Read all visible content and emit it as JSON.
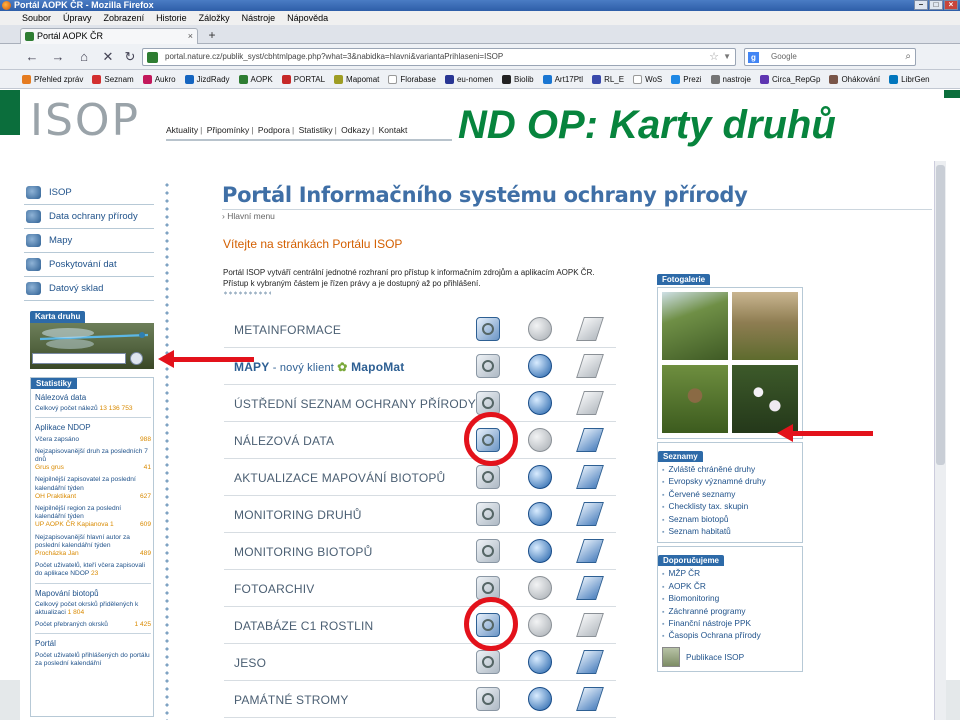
{
  "browser": {
    "window_title": "Portál AOPK ČR - Mozilla Firefox",
    "menu": [
      "Soubor",
      "Úpravy",
      "Zobrazení",
      "Historie",
      "Záložky",
      "Nástroje",
      "Nápověda"
    ],
    "tab_title": "Portál AOPK ČR",
    "url": "portal.nature.cz/publik_syst/cbhtmlpage.php?what=3&nabidka=hlavni&variantaPrihlaseni=ISOP",
    "search_placeholder": "Google",
    "bookmarks": [
      "Přehled zpráv",
      "Seznam",
      "Aukro",
      "JizdRady",
      "AOPK",
      "PORTAL",
      "Mapomat",
      "Florabase",
      "eu-nomen",
      "Biolib",
      "Art17Ptl",
      "RL_E",
      "WoS",
      "Prezi",
      "nastroje",
      "Circa_RepGp",
      "Ohákování",
      "LibrGen"
    ]
  },
  "header": {
    "logo_text": "ISOP",
    "nav": [
      "Aktuality",
      "Připomínky",
      "Podpora",
      "Statistiky",
      "Odkazy",
      "Kontakt"
    ],
    "slide_title": "ND OP: Karty druhů"
  },
  "left_menu": [
    "ISOP",
    "Data ochrany přírody",
    "Mapy",
    "Poskytování dat",
    "Datový sklad"
  ],
  "karta_druhu": {
    "label": "Karta druhu",
    "input_value": ""
  },
  "statistiky": {
    "label": "Statistiky",
    "nalezova_data": {
      "heading": "Nálezová data",
      "celkovy_label": "Celkový počet nálezů",
      "celkovy_value": "13 136 753"
    },
    "aplikace_ndop": {
      "heading": "Aplikace NDOP",
      "vcera_label": "Včera zapsáno",
      "vcera_value": "988",
      "druh_label": "Nejzapisovanější druh za posledních 7 dnů",
      "druh_name": "Grus grus",
      "druh_value": "41",
      "zapisovatel_label": "Nejpilnější zapisovatel za poslední kalendářní týden",
      "zapisovatel_name": "OH Praktikant",
      "zapisovatel_value": "627",
      "region_label": "Nejpilnější region za poslední kalendářní týden",
      "region_name": "UP AOPK ČR Kapianova 1",
      "region_value": "609",
      "autor_label": "Nejzapisovanější hlavní autor za poslední kalendářní týden",
      "autor_name": "Procházka Jan",
      "autor_value": "489",
      "uzivatele_label": "Počet uživatelů, kteří včera zapisovali do aplikace NDOP",
      "uzivatele_value": "23"
    },
    "mapovani": {
      "heading": "Mapování biotopů",
      "okrsky_label": "Celkový počet okrsků přidělených k aktualizaci",
      "okrsky_value": "1 804",
      "prebrane_label": "Počet přebraných okrsků",
      "prebrane_value": "1 425"
    },
    "portal": {
      "heading": "Portál",
      "label": "Počet uživatelů přihlášených do portálu za poslední kalendářní"
    }
  },
  "main": {
    "portal_title": "Portál Informačního systému ochrany přírody",
    "breadcrumb": "› Hlavní menu",
    "welcome": "Vítejte na stránkách Portálu ISOP",
    "intro_line1": "Portál ISOP vytváří centrální jednotné rozhraní pro přístup k informačním zdrojům a aplikacím AOPK ČR.",
    "intro_line2": "Přístup k vybraným částem je řízen právy a je dostupný až po přihlášení.",
    "apps": [
      {
        "name": "METAINFORMACE",
        "search": true,
        "globe": false,
        "doc": false
      },
      {
        "name": "MAPY",
        "extra": " - nový klient ",
        "extra2": "MapoMat",
        "search": false,
        "globe": true,
        "doc": false
      },
      {
        "name": "ÚSTŘEDNÍ SEZNAM OCHRANY PŘÍRODY",
        "search": false,
        "globe": true,
        "doc": false
      },
      {
        "name": "NÁLEZOVÁ DATA",
        "search": true,
        "globe": false,
        "doc": true
      },
      {
        "name": "AKTUALIZACE MAPOVÁNÍ BIOTOPŮ",
        "search": false,
        "globe": true,
        "doc": true
      },
      {
        "name": "MONITORING DRUHŮ",
        "search": false,
        "globe": true,
        "doc": true
      },
      {
        "name": "MONITORING BIOTOPŮ",
        "search": false,
        "globe": true,
        "doc": true
      },
      {
        "name": "FOTOARCHIV",
        "search": false,
        "globe": false,
        "doc": true
      },
      {
        "name": "DATABÁZE C1 ROSTLIN",
        "search": true,
        "globe": false,
        "doc": false
      },
      {
        "name": "JESO",
        "search": false,
        "globe": true,
        "doc": true
      },
      {
        "name": "PAMÁTNÉ STROMY",
        "search": false,
        "globe": true,
        "doc": true
      }
    ]
  },
  "right": {
    "fotogalerie_label": "Fotogalerie",
    "seznamy_label": "Seznamy",
    "seznamy": [
      "Zvláště chráněné druhy",
      "Evropsky významné druhy",
      "Červené seznamy",
      "Checklisty tax. skupin",
      "Seznam biotopů",
      "Seznam habitatů"
    ],
    "doporucujeme_label": "Doporučujeme",
    "doporucujeme": [
      "MŽP ČR",
      "AOPK ČR",
      "Biomonitoring",
      "Záchranné programy",
      "Finanční nástroje PPK",
      "Časopis Ochrana přírody"
    ],
    "publikace": "Publikace ISOP"
  },
  "colors": {
    "accent_green": "#07843d",
    "portal_blue": "#2d6aa8",
    "annotation_red": "#e3121b"
  }
}
